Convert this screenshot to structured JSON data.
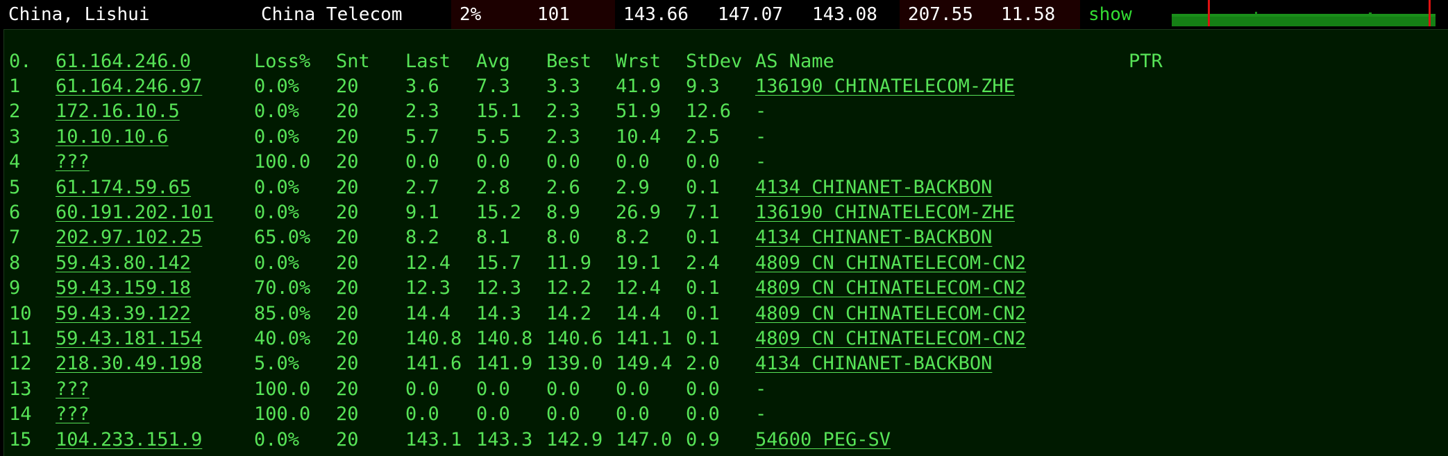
{
  "header": {
    "location": "China, Lishui",
    "isp": "China Telecom",
    "loss": "2%",
    "sent": "101",
    "last": "143.66",
    "avg": "147.07",
    "best": "143.08",
    "worst": "207.55",
    "stdev": "11.58",
    "show_label": "show"
  },
  "colors": {
    "text_green": "#57e357",
    "panel_bg": "#001a00",
    "graph_green": "#1a8f1a",
    "graph_spike_red": "#dd1111"
  },
  "table": {
    "headers": {
      "hop": "0.",
      "host": "61.164.246.0",
      "loss": "Loss%",
      "snt": "Snt",
      "last": "Last",
      "avg": "Avg",
      "best": "Best",
      "wrst": "Wrst",
      "stdev": "StDev",
      "as": "AS Name",
      "ptr": "PTR"
    },
    "rows": [
      {
        "hop": "1",
        "host": "61.164.246.97",
        "loss": "0.0%",
        "snt": "20",
        "last": "3.6",
        "avg": "7.3",
        "best": "3.3",
        "wrst": "41.9",
        "stdev": "9.3",
        "as": "136190 CHINATELECOM-ZHE"
      },
      {
        "hop": "2",
        "host": "172.16.10.5",
        "loss": "0.0%",
        "snt": "20",
        "last": "2.3",
        "avg": "15.1",
        "best": "2.3",
        "wrst": "51.9",
        "stdev": "12.6",
        "as": "-"
      },
      {
        "hop": "3",
        "host": "10.10.10.6",
        "loss": "0.0%",
        "snt": "20",
        "last": "5.7",
        "avg": "5.5",
        "best": "2.3",
        "wrst": "10.4",
        "stdev": "2.5",
        "as": "-"
      },
      {
        "hop": "4",
        "host": "???",
        "loss": "100.0",
        "snt": "20",
        "last": "0.0",
        "avg": "0.0",
        "best": "0.0",
        "wrst": "0.0",
        "stdev": "0.0",
        "as": "-"
      },
      {
        "hop": "5",
        "host": "61.174.59.65",
        "loss": "0.0%",
        "snt": "20",
        "last": "2.7",
        "avg": "2.8",
        "best": "2.6",
        "wrst": "2.9",
        "stdev": "0.1",
        "as": "4134  CHINANET-BACKBON"
      },
      {
        "hop": "6",
        "host": "60.191.202.101",
        "loss": "0.0%",
        "snt": "20",
        "last": "9.1",
        "avg": "15.2",
        "best": "8.9",
        "wrst": "26.9",
        "stdev": "7.1",
        "as": "136190 CHINATELECOM-ZHE"
      },
      {
        "hop": "7",
        "host": "202.97.102.25",
        "loss": "65.0%",
        "snt": "20",
        "last": "8.2",
        "avg": "8.1",
        "best": "8.0",
        "wrst": "8.2",
        "stdev": "0.1",
        "as": "4134  CHINANET-BACKBON"
      },
      {
        "hop": "8",
        "host": "59.43.80.142",
        "loss": "0.0%",
        "snt": "20",
        "last": "12.4",
        "avg": "15.7",
        "best": "11.9",
        "wrst": "19.1",
        "stdev": "2.4",
        "as": "4809  CN CHINATELECOM-CN2"
      },
      {
        "hop": "9",
        "host": "59.43.159.18",
        "loss": "70.0%",
        "snt": "20",
        "last": "12.3",
        "avg": "12.3",
        "best": "12.2",
        "wrst": "12.4",
        "stdev": "0.1",
        "as": "4809  CN CHINATELECOM-CN2"
      },
      {
        "hop": "10",
        "host": "59.43.39.122",
        "loss": "85.0%",
        "snt": "20",
        "last": "14.4",
        "avg": "14.3",
        "best": "14.2",
        "wrst": "14.4",
        "stdev": "0.1",
        "as": "4809  CN CHINATELECOM-CN2"
      },
      {
        "hop": "11",
        "host": "59.43.181.154",
        "loss": "40.0%",
        "snt": "20",
        "last": "140.8",
        "avg": "140.8",
        "best": "140.6",
        "wrst": "141.1",
        "stdev": "0.1",
        "as": "4809  CN CHINATELECOM-CN2"
      },
      {
        "hop": "12",
        "host": "218.30.49.198",
        "loss": "5.0%",
        "snt": "20",
        "last": "141.6",
        "avg": "141.9",
        "best": "139.0",
        "wrst": "149.4",
        "stdev": "2.0",
        "as": "4134  CHINANET-BACKBON"
      },
      {
        "hop": "13",
        "host": "???",
        "loss": "100.0",
        "snt": "20",
        "last": "0.0",
        "avg": "0.0",
        "best": "0.0",
        "wrst": "0.0",
        "stdev": "0.0",
        "as": "-"
      },
      {
        "hop": "14",
        "host": "???",
        "loss": "100.0",
        "snt": "20",
        "last": "0.0",
        "avg": "0.0",
        "best": "0.0",
        "wrst": "0.0",
        "stdev": "0.0",
        "as": "-"
      },
      {
        "hop": "15",
        "host": "104.233.151.9",
        "loss": "0.0%",
        "snt": "20",
        "last": "143.1",
        "avg": "143.3",
        "best": "142.9",
        "wrst": "147.0",
        "stdev": "0.9",
        "as": "54600 PEG-SV"
      }
    ]
  }
}
